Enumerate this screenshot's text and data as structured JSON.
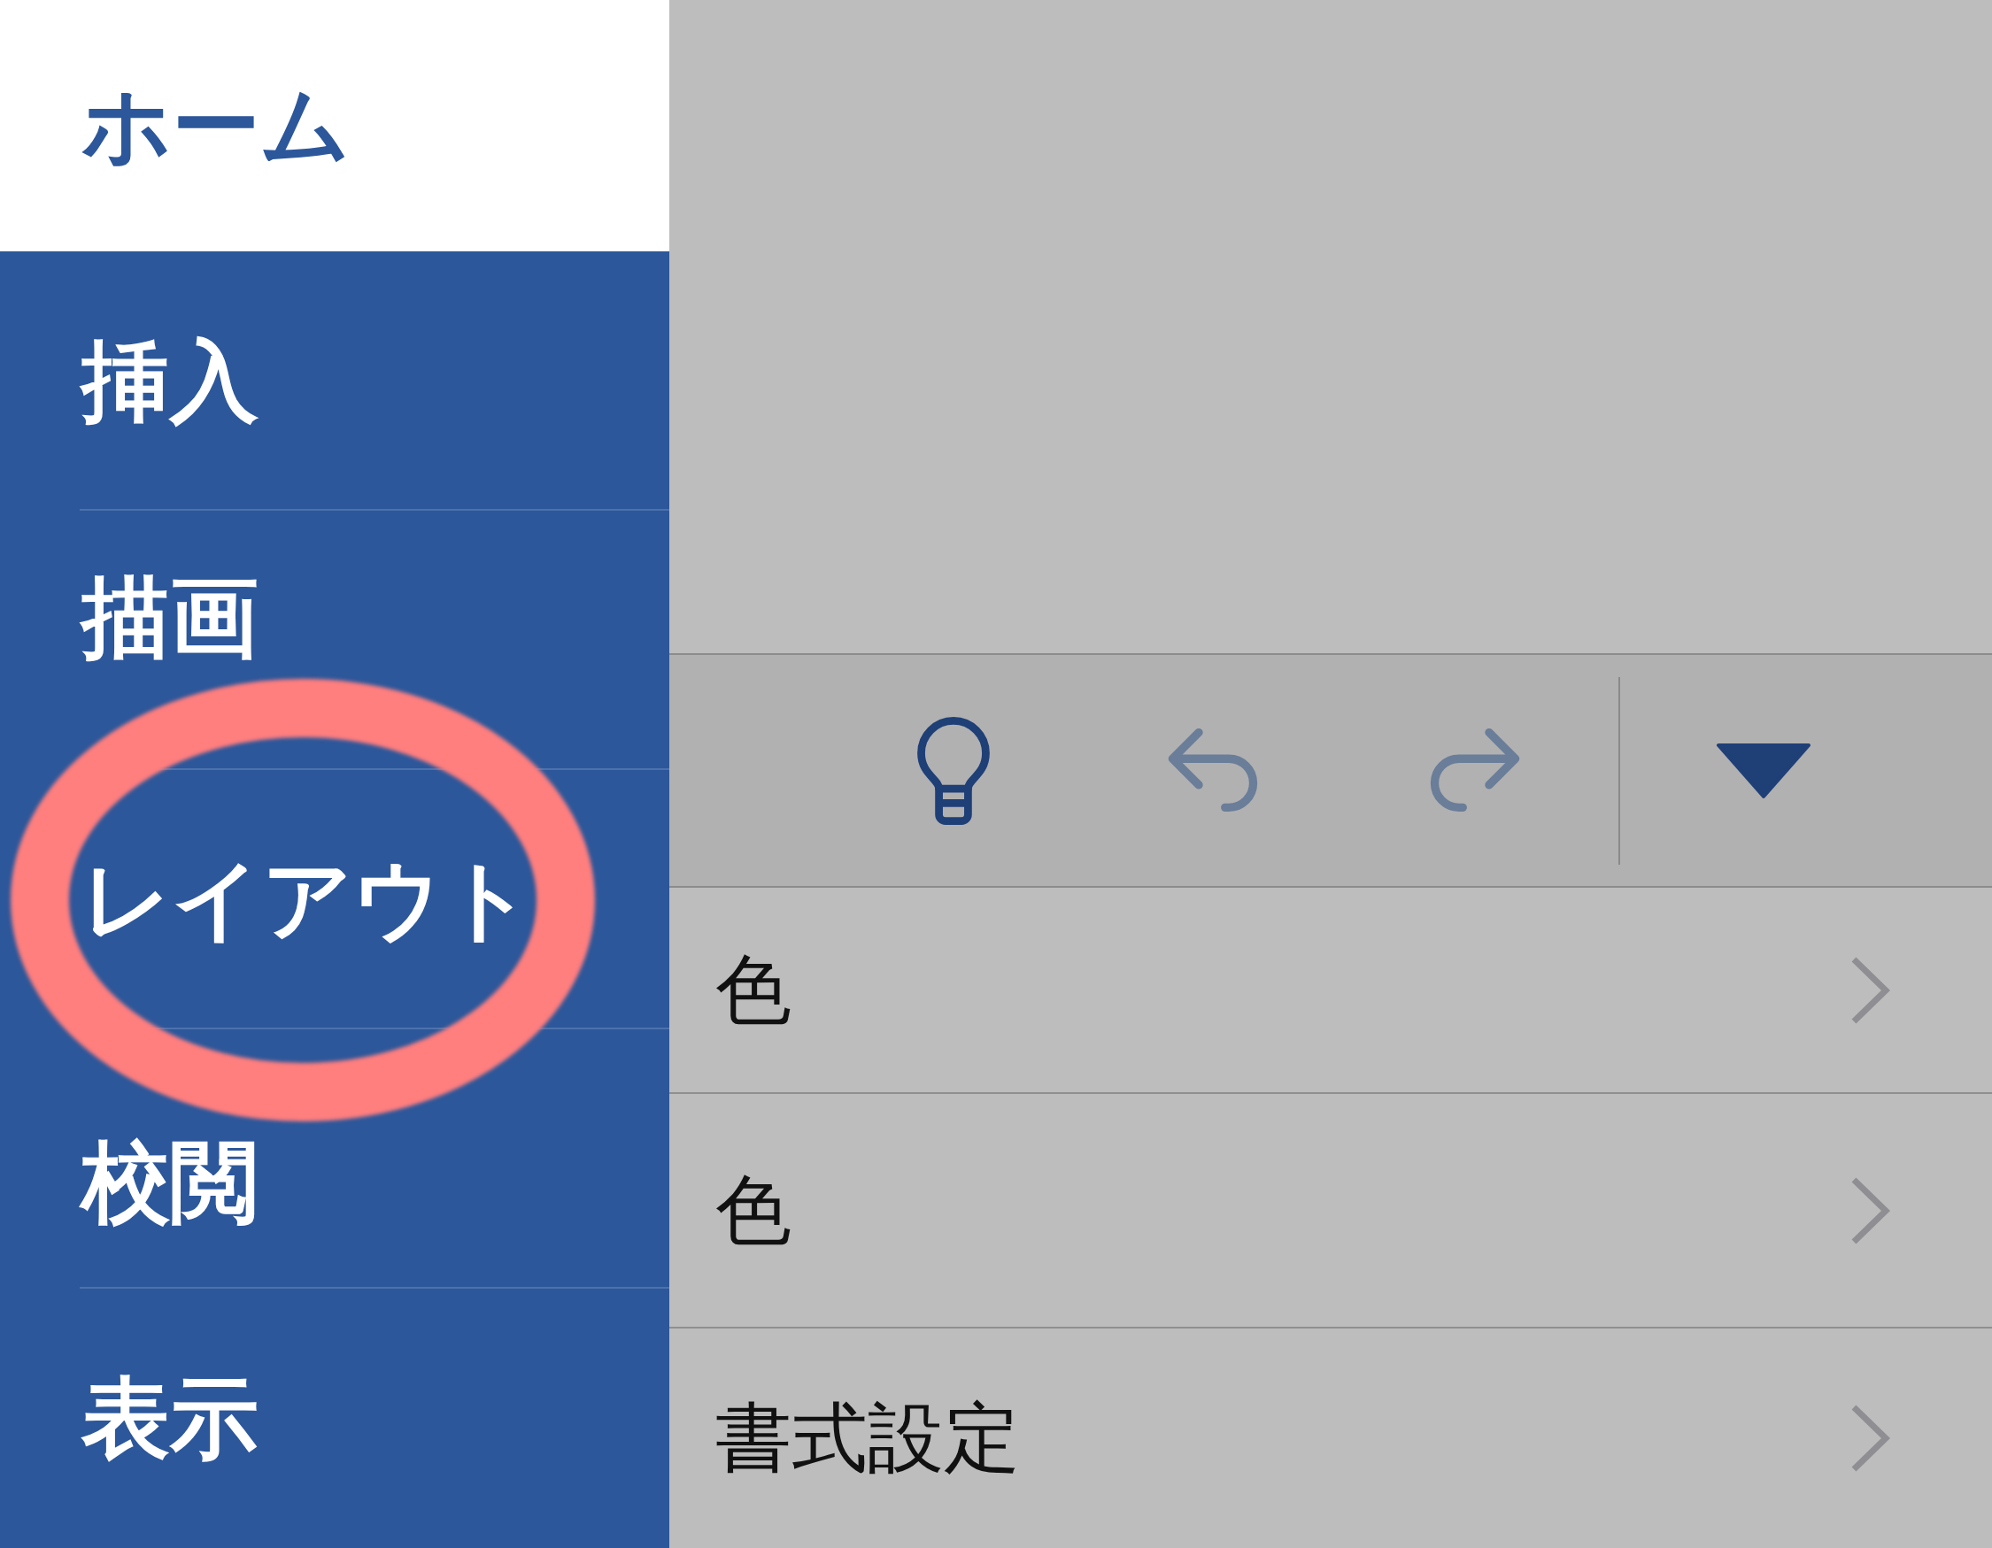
{
  "sidebar": {
    "items": [
      {
        "label": "ホーム",
        "selected": true,
        "circled": false
      },
      {
        "label": "挿入",
        "selected": false,
        "circled": false
      },
      {
        "label": "描画",
        "selected": false,
        "circled": false
      },
      {
        "label": "レイアウト",
        "selected": false,
        "circled": true
      },
      {
        "label": "校閲",
        "selected": false,
        "circled": false
      },
      {
        "label": "表示",
        "selected": false,
        "circled": false
      }
    ]
  },
  "toolbar": {
    "buttons": [
      {
        "kind": "lightbulb",
        "disabled": false
      },
      {
        "kind": "undo",
        "disabled": true
      },
      {
        "kind": "redo",
        "disabled": true
      },
      {
        "kind": "dropdown",
        "disabled": false
      }
    ]
  },
  "list": {
    "rows": [
      {
        "label": "色"
      },
      {
        "label": "色"
      },
      {
        "label": "書式設定"
      }
    ]
  }
}
